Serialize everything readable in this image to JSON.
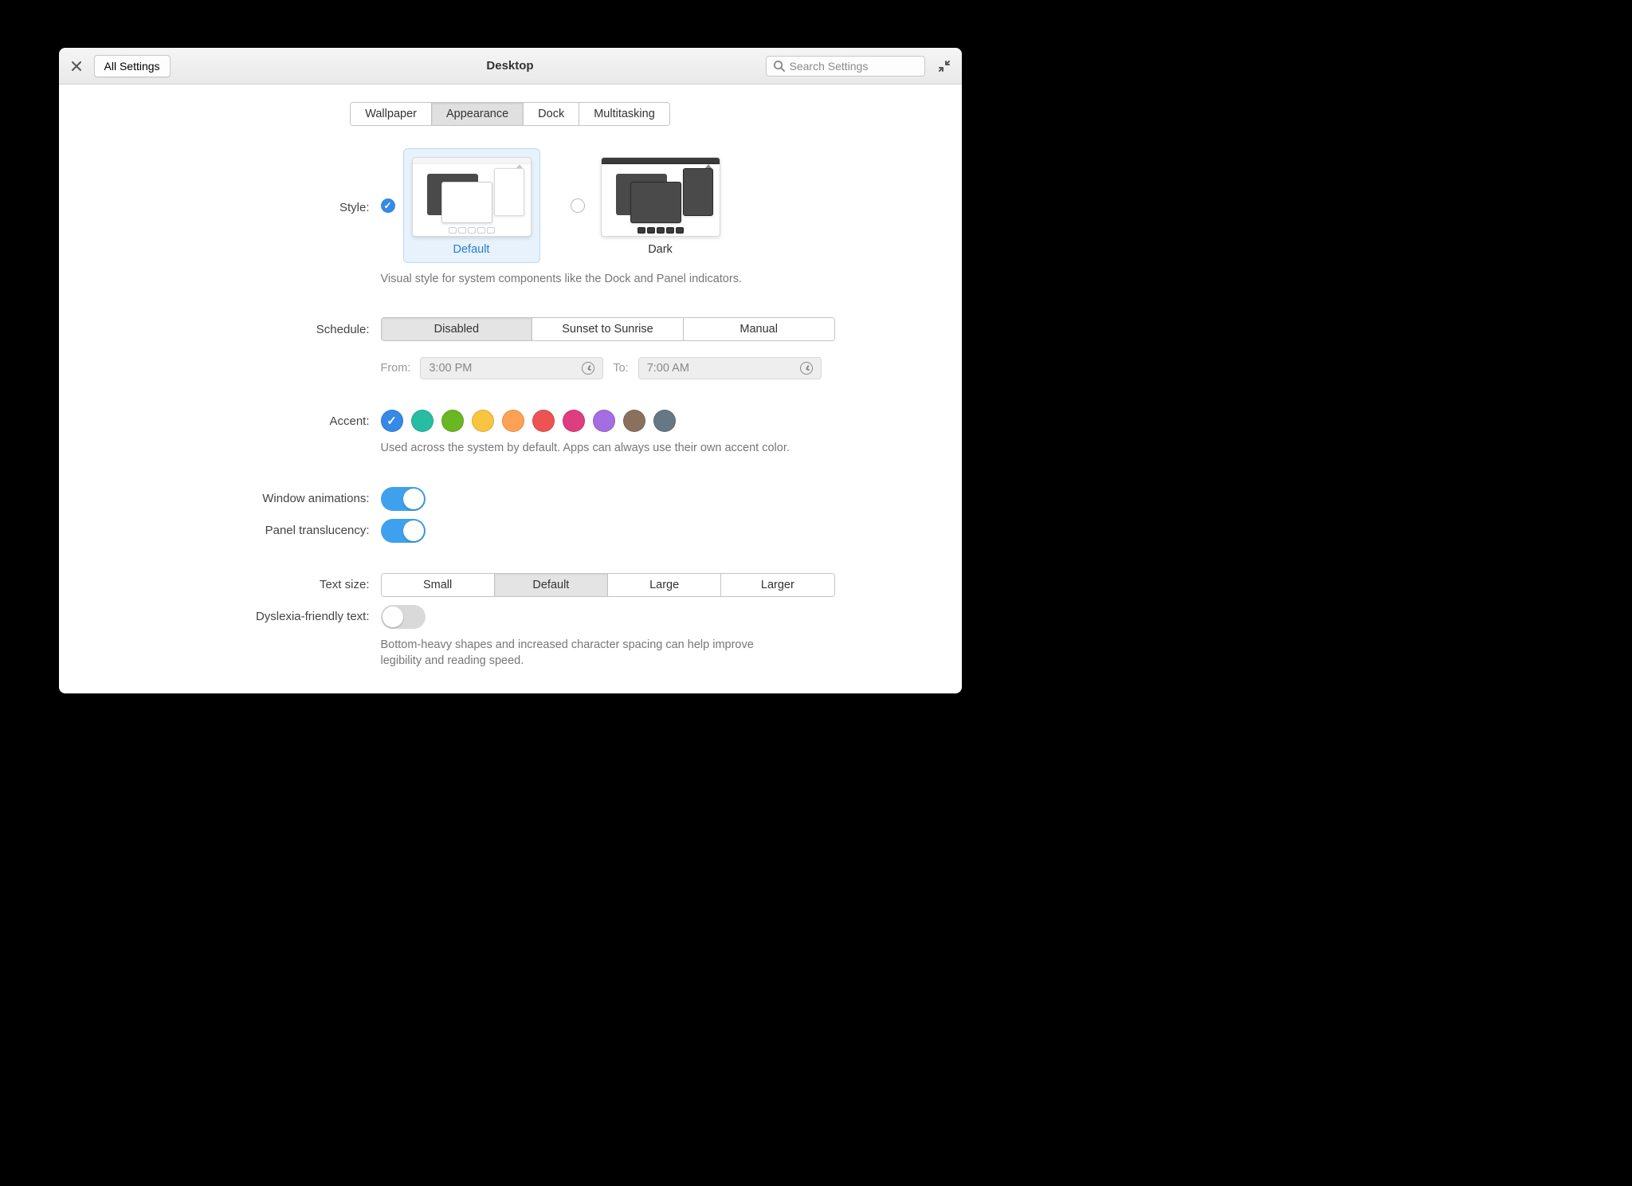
{
  "header": {
    "all_settings": "All Settings",
    "title": "Desktop",
    "search_placeholder": "Search Settings"
  },
  "tabs": [
    "Wallpaper",
    "Appearance",
    "Dock",
    "Multitasking"
  ],
  "tabs_active": "Appearance",
  "style": {
    "label": "Style:",
    "options": {
      "default": "Default",
      "dark": "Dark"
    },
    "desc": "Visual style for system components like the Dock and Panel indicators."
  },
  "schedule": {
    "label": "Schedule:",
    "options": [
      "Disabled",
      "Sunset to Sunrise",
      "Manual"
    ],
    "active": "Disabled",
    "from_label": "From:",
    "from_value": "3:00 PM",
    "to_label": "To:",
    "to_value": "7:00 AM"
  },
  "accent": {
    "label": "Accent:",
    "colors": [
      "#3689e6",
      "#28bca3",
      "#68b723",
      "#f9c440",
      "#ffa154",
      "#ed5353",
      "#de3e80",
      "#a56de2",
      "#8a715e",
      "#667885"
    ],
    "desc": "Used across the system by default. Apps can always use their own accent color."
  },
  "window_animations": {
    "label": "Window animations:"
  },
  "panel_translucency": {
    "label": "Panel translucency:"
  },
  "text_size": {
    "label": "Text size:",
    "options": [
      "Small",
      "Default",
      "Large",
      "Larger"
    ],
    "active": "Default"
  },
  "dyslexia": {
    "label": "Dyslexia-friendly text:",
    "desc": "Bottom-heavy shapes and increased character spacing can help improve legibility and reading speed."
  }
}
